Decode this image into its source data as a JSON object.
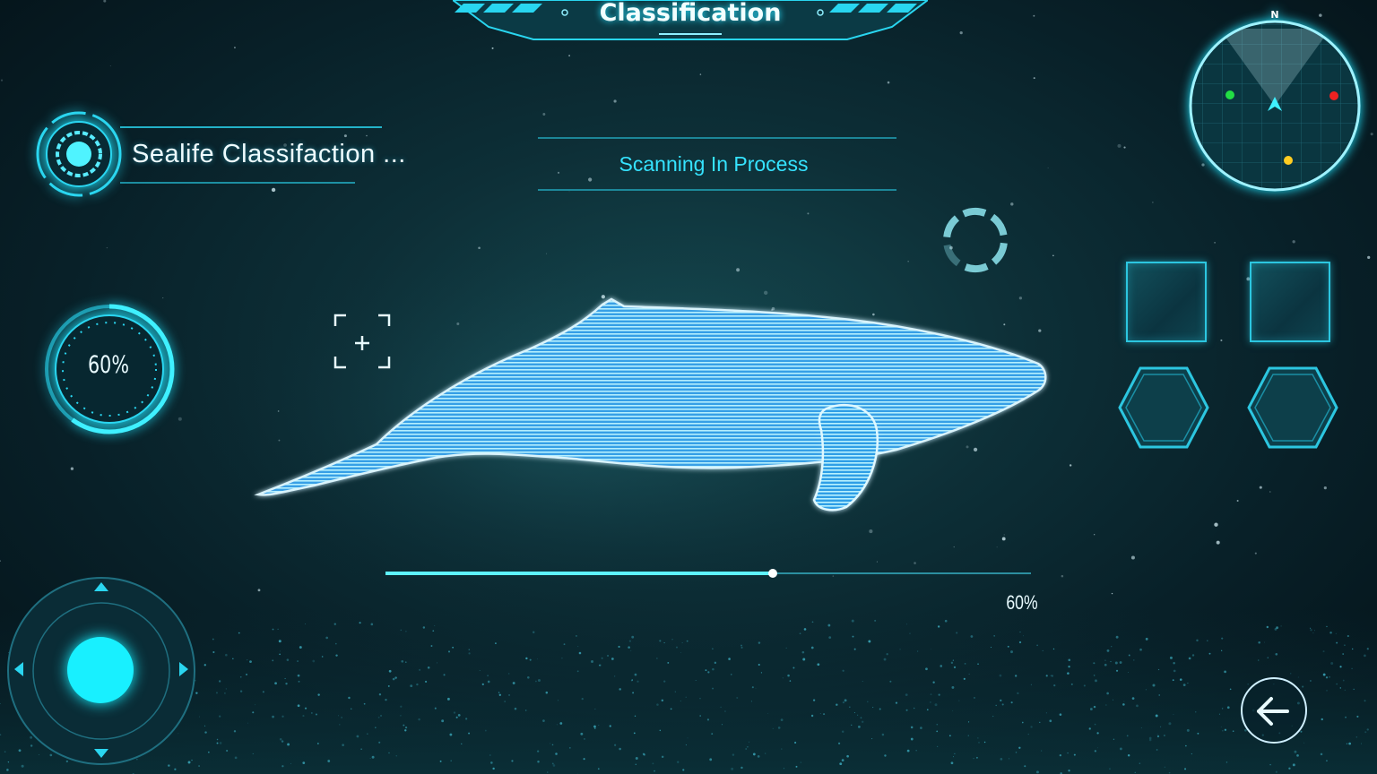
{
  "header": {
    "title": "Classification"
  },
  "sealife_panel": {
    "title": "Sealife Classifaction ..."
  },
  "scan": {
    "status": "Scanning In Process"
  },
  "scan_ring": {
    "percent_text": "60%",
    "value": 0.6
  },
  "progress": {
    "percent_text": "60%",
    "value": 0.6
  },
  "radar": {
    "compass_label": "N",
    "markers": [
      {
        "color": "#22dd44"
      },
      {
        "color": "#ee2222"
      },
      {
        "color": "#ffcc22"
      }
    ]
  },
  "slots": [
    {
      "shape": "square"
    },
    {
      "shape": "square"
    },
    {
      "shape": "hexagon"
    },
    {
      "shape": "hexagon"
    }
  ],
  "joystick": {
    "arrows": [
      "up",
      "down",
      "left",
      "right"
    ]
  },
  "icons": {
    "back": "arrow-left-icon",
    "target": "crosshair-icon",
    "loading": "loading-spinner-icon"
  },
  "colors": {
    "accent": "#22e6ff",
    "background": "#0b2a33",
    "hologram": "#5fd6ff"
  }
}
